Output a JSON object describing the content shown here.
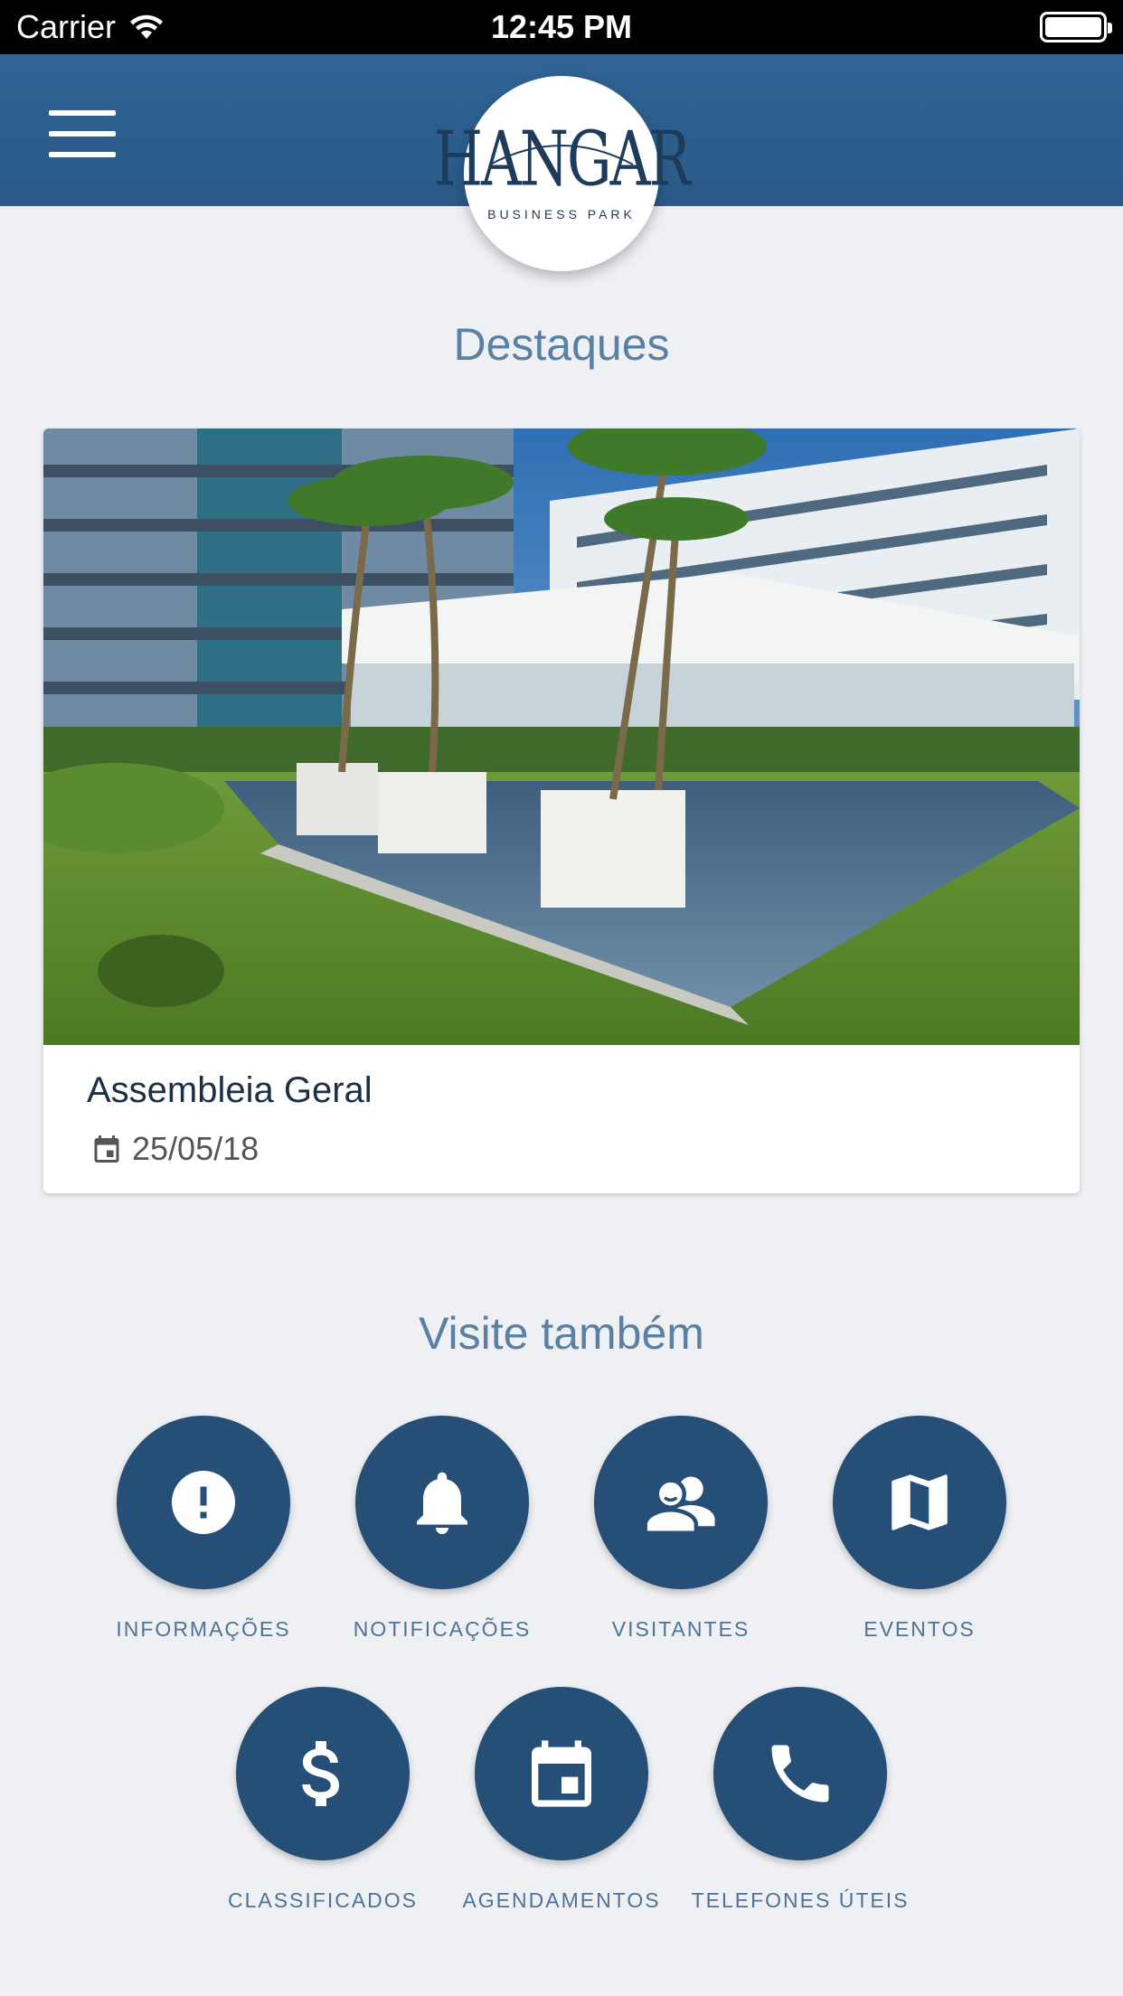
{
  "status_bar": {
    "carrier": "Carrier",
    "time": "12:45 PM"
  },
  "header": {
    "logo_text": "HANGAR",
    "logo_subtext": "BUSINESS PARK"
  },
  "highlights": {
    "title": "Destaques",
    "card": {
      "title": "Assembleia Geral",
      "date": "25/05/18",
      "image": "building-courtyard-photo"
    }
  },
  "visit": {
    "title": "Visite também",
    "items": [
      {
        "label": "INFORMAÇÕES",
        "icon": "exclamation-icon"
      },
      {
        "label": "NOTIFICAÇÕES",
        "icon": "bell-icon"
      },
      {
        "label": "VISITANTES",
        "icon": "visitors-icon"
      },
      {
        "label": "EVENTOS",
        "icon": "map-icon"
      },
      {
        "label": "CLASSIFICADOS",
        "icon": "dollar-icon"
      },
      {
        "label": "AGENDAMENTOS",
        "icon": "calendar-icon"
      },
      {
        "label": "TELEFONES ÚTEIS",
        "icon": "phone-icon"
      }
    ]
  },
  "colors": {
    "header": "#2a5a87",
    "accent": "#264f78",
    "title": "#5a80a6",
    "background": "#eef0f4"
  }
}
